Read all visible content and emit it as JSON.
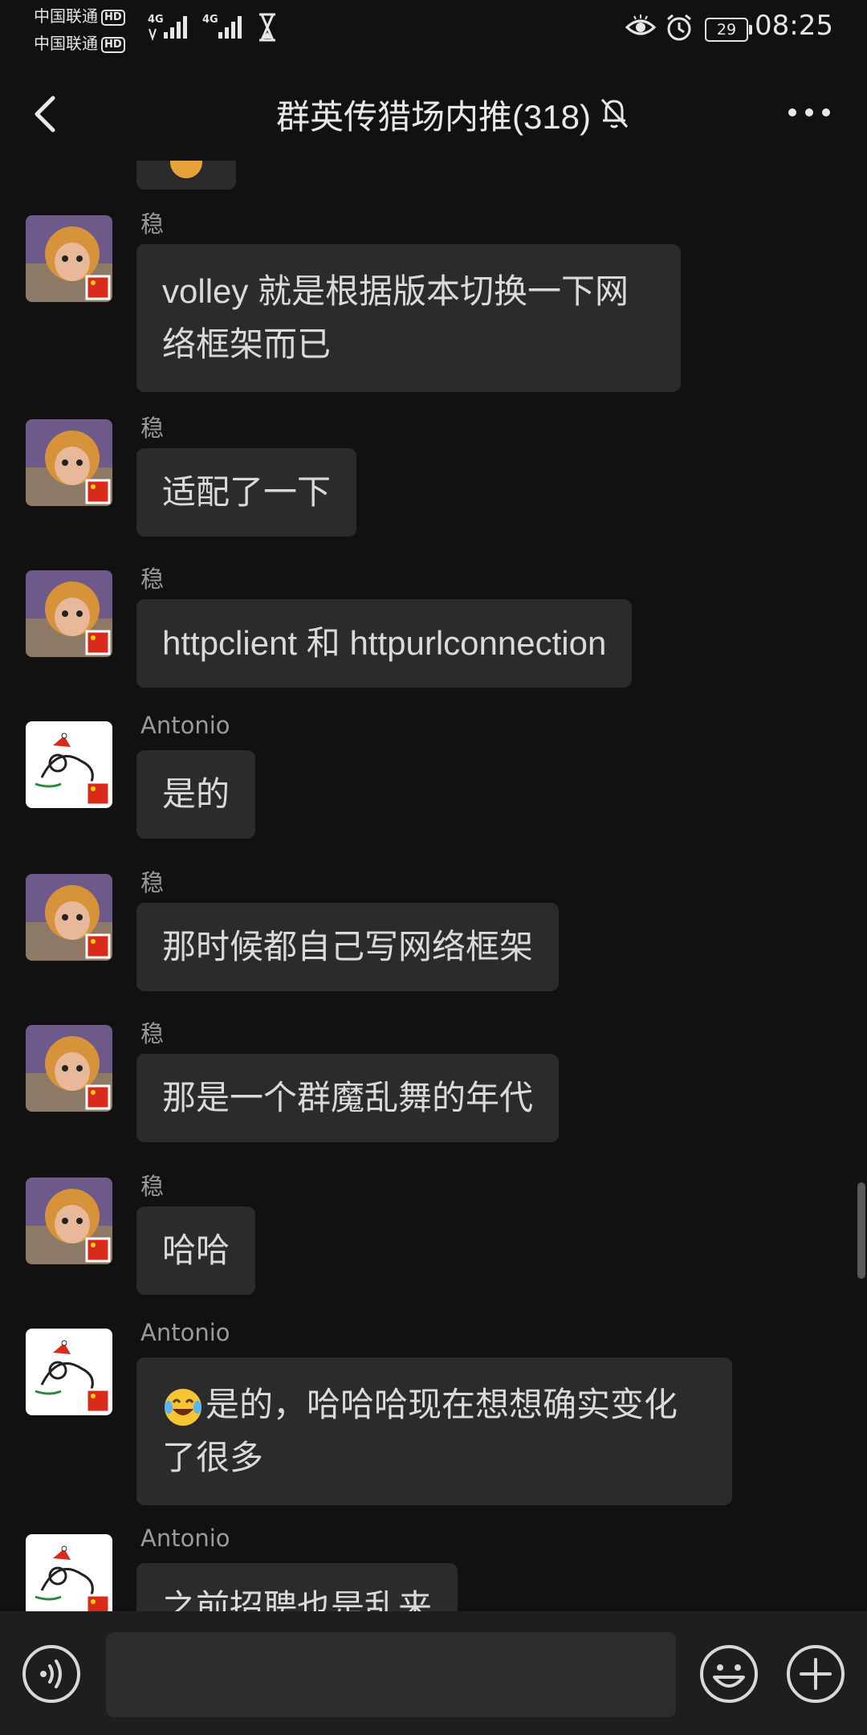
{
  "status_bar": {
    "carrier_1": "中国联通",
    "carrier_2": "中国联通",
    "hd_label": "HD",
    "network": "4G",
    "battery": "29",
    "time": "08:25"
  },
  "header": {
    "title": "群英传猎场内推(318)",
    "back_icon": "chevron-left-icon",
    "mute_icon": "bell-off-icon",
    "more_icon": "more-horizontal-icon"
  },
  "messages": [
    {
      "sender": "稳",
      "avatar": "monkey",
      "text": "volley 就是根据版本切换一下网络框架而已"
    },
    {
      "sender": "稳",
      "avatar": "monkey",
      "text": "适配了一下"
    },
    {
      "sender": "稳",
      "avatar": "monkey",
      "text": "httpclient 和 httpurlconnection"
    },
    {
      "sender": "Antonio",
      "avatar": "dog",
      "text": "是的"
    },
    {
      "sender": "稳",
      "avatar": "monkey",
      "text": "那时候都自己写网络框架"
    },
    {
      "sender": "稳",
      "avatar": "monkey",
      "text": "那是一个群魔乱舞的年代"
    },
    {
      "sender": "稳",
      "avatar": "monkey",
      "text": "哈哈"
    },
    {
      "sender": "Antonio",
      "avatar": "dog",
      "emoji": "laughing-tears-emoji",
      "text": "是的，哈哈哈现在想想确实变化了很多"
    },
    {
      "sender": "Antonio",
      "avatar": "dog",
      "text": "之前招聘也是乱来"
    }
  ],
  "input_bar": {
    "voice_icon": "voice-icon",
    "emoji_icon": "smile-icon",
    "plus_icon": "plus-icon",
    "value": ""
  }
}
